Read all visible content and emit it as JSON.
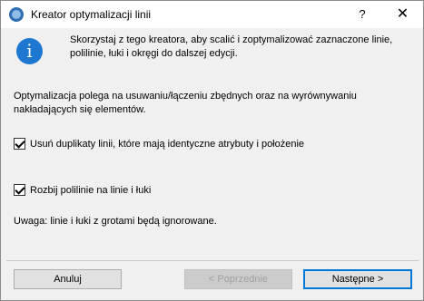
{
  "titlebar": {
    "title": "Kreator optymalizacji linii",
    "help_label": "?",
    "close_label": "✕"
  },
  "info_icon": {
    "glyph": "i",
    "color": "#1e78d1"
  },
  "intro": "Skorzystaj z tego kreatora, aby scalić i zoptymalizować zaznaczone linie, polilinie, łuki i okręgi do dalszej edycji.",
  "description": "Optymalizacja polega na usuwaniu/łączeniu zbędnych oraz na wyrównywaniu nakładających się elementów.",
  "options": [
    {
      "label": "Usuń duplikaty linii, które mają identyczne atrybuty i położenie",
      "checked": true
    },
    {
      "label": "Rozbij polilinie na linie i łuki",
      "checked": true
    }
  ],
  "note": "Uwaga: linie i łuki z grotami będą ignorowane.",
  "buttons": {
    "cancel": "Anuluj",
    "previous": "< Poprzednie",
    "next": "Następne >"
  }
}
